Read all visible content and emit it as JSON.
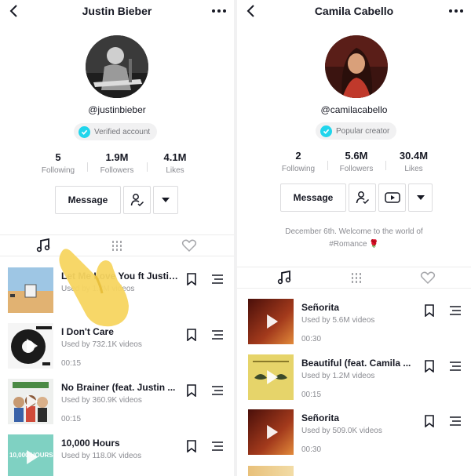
{
  "left": {
    "header": {
      "title": "Justin Bieber"
    },
    "profile": {
      "handle": "@justinbieber",
      "badge": "Verified account"
    },
    "stats": [
      {
        "value": "5",
        "label": "Following"
      },
      {
        "value": "1.9M",
        "label": "Followers"
      },
      {
        "value": "4.1M",
        "label": "Likes"
      }
    ],
    "message_label": "Message",
    "songs": [
      {
        "title": "Let Me Love You ft Justin ...",
        "meta": "Used by 1.3M videos",
        "duration": ""
      },
      {
        "title": "I Don't Care",
        "meta": "Used by 732.1K videos",
        "duration": "00:15"
      },
      {
        "title": "No Brainer (feat. Justin ...",
        "meta": "Used by 360.9K videos",
        "duration": "00:15"
      },
      {
        "title": "10,000 Hours",
        "meta": "Used by 118.0K videos",
        "duration": ""
      }
    ],
    "thumb_text": {
      "hours": "10,000 HOURS"
    }
  },
  "right": {
    "header": {
      "title": "Camila Cabello"
    },
    "profile": {
      "handle": "@camilacabello",
      "badge": "Popular creator"
    },
    "stats": [
      {
        "value": "2",
        "label": "Following"
      },
      {
        "value": "5.6M",
        "label": "Followers"
      },
      {
        "value": "30.4M",
        "label": "Likes"
      }
    ],
    "message_label": "Message",
    "bio_line1": "December 6th. Welcome to the world of",
    "bio_line2": "#Romance 🌹",
    "songs": [
      {
        "title": "Señorita",
        "meta": "Used by 5.6M videos",
        "duration": "00:30"
      },
      {
        "title": "Beautiful (feat. Camila ...",
        "meta": "Used by 1.2M videos",
        "duration": "00:15"
      },
      {
        "title": "Señorita",
        "meta": "Used by 509.0K videos",
        "duration": "00:30"
      }
    ]
  },
  "colors": {
    "accent": "#20d5ec",
    "text": "#161823",
    "muted": "#8a8b91",
    "tap_hand": "#f7d560"
  }
}
